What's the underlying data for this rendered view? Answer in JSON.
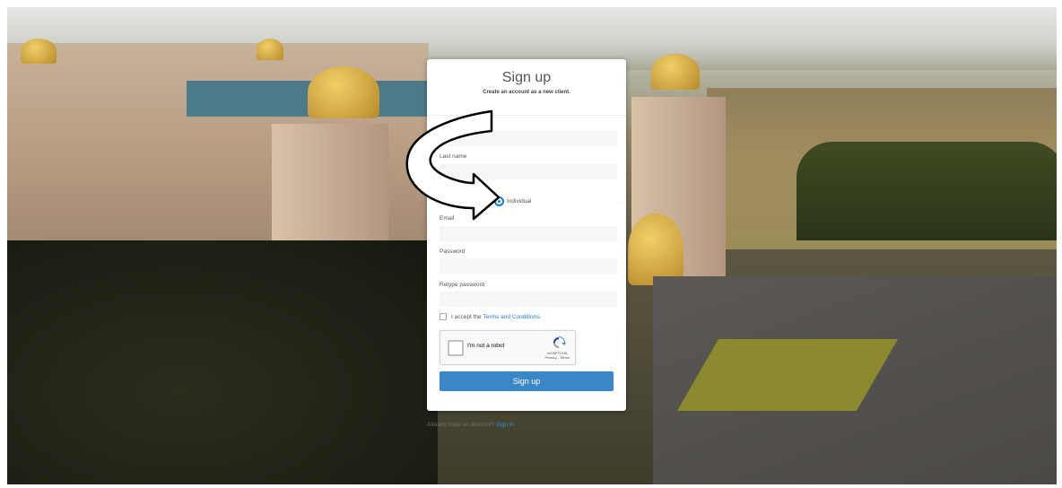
{
  "form": {
    "title": "Sign up",
    "subtitle": "Create an account as a new client.",
    "last_name_label": "Last name",
    "individual_label": "Individual",
    "email_label": "Email",
    "password_label": "Password",
    "retype_password_label": "Retype password",
    "terms_prefix": "I accept the",
    "terms_link": "Terms and Conditions.",
    "recaptcha_label": "I'm not a robot",
    "recaptcha_brand": "reCAPTCHA",
    "recaptcha_links": "Privacy - Terms",
    "submit_label": "Sign up"
  },
  "footer": {
    "prompt": "Already have an account?",
    "signin_link": "Sign in"
  },
  "colors": {
    "accent": "#3b86c6",
    "link": "#1f7ad6"
  },
  "icons": [
    "curved-arrow-icon",
    "recaptcha-icon"
  ]
}
